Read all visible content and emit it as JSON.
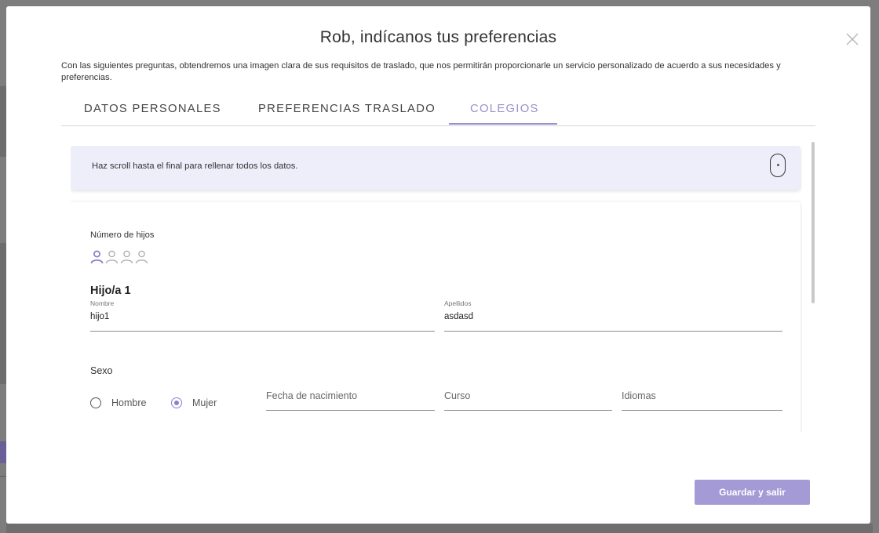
{
  "modal": {
    "title": "Rob, indícanos tus preferencias",
    "intro": "Con las siguientes preguntas, obtendremos una imagen clara de sus requisitos de traslado, que nos permitirán proporcionarle un servicio personalizado de acuerdo a sus necesidades y preferencias.",
    "close_icon": "close-icon"
  },
  "tabs": [
    {
      "label": "DATOS PERSONALES",
      "active": false
    },
    {
      "label": "PREFERENCIAS TRASLADO",
      "active": false
    },
    {
      "label": "COLEGIOS",
      "active": true
    }
  ],
  "notice": {
    "text": "Haz scroll hasta el final para rellenar todos los datos.",
    "icon": "mouse-scroll-icon"
  },
  "form": {
    "num_children_label": "Número de hijos",
    "num_children_selected": 1,
    "num_children_options": 4,
    "child": {
      "title": "Hijo/a 1",
      "nombre_label": "Nombre",
      "nombre_value": "hijo1",
      "apellidos_label": "Apellidos",
      "apellidos_value": "asdasd",
      "sexo_label": "Sexo",
      "sexo_options": [
        "Hombre",
        "Mujer"
      ],
      "sexo_selected": "Mujer",
      "fecha_placeholder": "Fecha de nacimiento",
      "curso_placeholder": "Curso",
      "idiomas_placeholder": "Idiomas"
    }
  },
  "footer": {
    "save_label": "Guardar y salir"
  },
  "colors": {
    "accent": "#9a8fcf",
    "button": "#a49bd6",
    "notice_bg": "#eeedfa"
  }
}
